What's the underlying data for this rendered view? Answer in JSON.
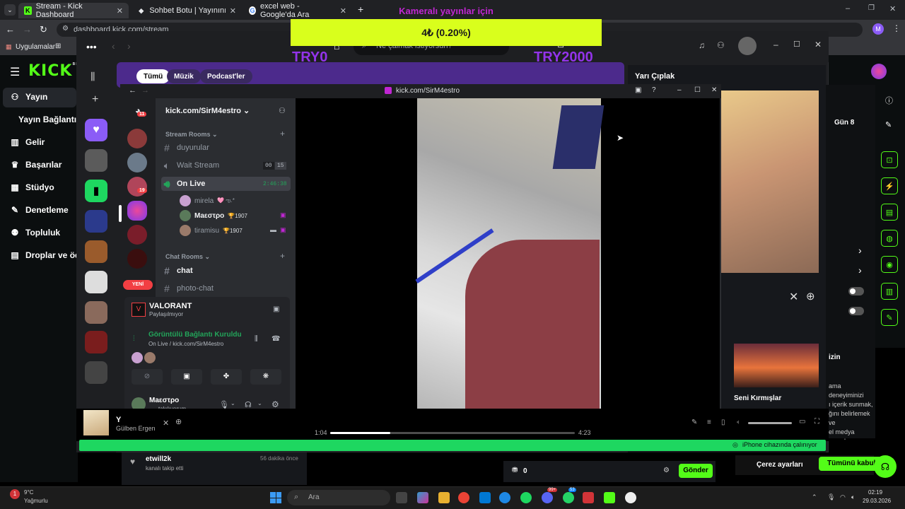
{
  "browser": {
    "tabs": [
      {
        "title": "Stream - Kick Dashboard",
        "active": true
      },
      {
        "title": "Sohbet Botu | Yayınını güçlendi"
      },
      {
        "title": "excel web - Google'da Ara"
      }
    ],
    "address": "dashboard.kick.com/stream",
    "bookmarks_label": "Uygulamalar",
    "profile_initial": "M"
  },
  "overlay": {
    "caption": "Kameralı yayınlar için",
    "progress_text": "4₺ (0.20%)",
    "progress_value": 0.2,
    "left_label": "TRY0",
    "right_label": "TRY2000"
  },
  "kick": {
    "logo": "KICK",
    "logo_badge": "BETA",
    "nav": [
      {
        "label": "Yayın",
        "icon": "broadcast-icon"
      },
      {
        "label": "Yayın Bağlantısı",
        "icon": "link-icon"
      },
      {
        "label": "Gelir",
        "icon": "chart-icon"
      },
      {
        "label": "Başarılar",
        "icon": "trophy-icon"
      },
      {
        "label": "Stüdyo",
        "icon": "studio-icon"
      },
      {
        "label": "Denetleme",
        "icon": "wrench-icon"
      },
      {
        "label": "Topluluk",
        "icon": "community-icon"
      },
      {
        "label": "Droplar ve ödü",
        "icon": "drops-icon"
      }
    ],
    "search_placeholder": "Ne çalmak istiyorsun?",
    "chips": [
      "Tümü",
      "Müzik",
      "Podcast'ler"
    ],
    "right_title": "Yarı Çıplak",
    "right_gun": "Gün 8",
    "album_label": "Seni Kırmışlar",
    "cookie_title": "izin",
    "cookie_text": "ama deneyiminizi\nı içerik sunmak,\nğını belirlemek ve\nel medya amaçları\nünü Kabul Et\"\nullanımını kabul",
    "cookie_settings": "Çerez ayarları",
    "accept_all": "Tümünü kabul",
    "chat_user": "etwill2k",
    "chat_msg": "kanalı takip etti",
    "chat_time": "56 dakika önce",
    "send_button": "Gönder",
    "points": "0"
  },
  "discord": {
    "window_title": "kick.com/SirM4estro",
    "server_name": "kick.com/SirM4estro",
    "categories": {
      "stream": "Stream Rooms",
      "chat": "Chat Rooms"
    },
    "channels": [
      {
        "name": "duyurular",
        "type": "text"
      },
      {
        "name": "Wait Stream",
        "type": "voice",
        "count_a": "00",
        "count_b": "15"
      },
      {
        "name": "On Live",
        "type": "voice",
        "timer": "2:46:38",
        "active": true
      },
      {
        "name": "chat",
        "type": "text"
      },
      {
        "name": "photo-chat",
        "type": "text"
      }
    ],
    "voice_users": [
      {
        "name": "mirela",
        "badge": "🩷 ఌ︎.*"
      },
      {
        "name": "Μaεστρο",
        "badge": "🏆1907"
      },
      {
        "name": "tiramisu",
        "badge": "🏆1907"
      }
    ],
    "new_badge": "YENİ",
    "guild_badges": [
      "11",
      "19"
    ],
    "activity_title": "VALORANT",
    "activity_sub": "Paylaşılmıyor",
    "voice_status": "Görüntülü Bağlantı Kuruldu",
    "voice_sub": "On Live / kick.com/SirM4estro",
    "me_name": "Μaεστρο",
    "me_status": "takılıyorum"
  },
  "player": {
    "song": "Y",
    "artist": "Gülben Ergen",
    "elapsed": "1:04",
    "total": "4:23",
    "progress": 0.245,
    "device_text": "iPhone cihazında çalınıyor"
  },
  "taskbar": {
    "weather_temp": "9°C",
    "weather_text": "Yağmurlu",
    "search_placeholder": "Ara",
    "time": "02:19",
    "date": "29.03.2026",
    "badges": [
      "99+",
      "53"
    ]
  },
  "colors": {
    "kick_green": "#53fc18",
    "discord_bg": "#2b2d31",
    "banner_yellow": "#d9ff1c",
    "spotify_green": "#1ed760"
  }
}
